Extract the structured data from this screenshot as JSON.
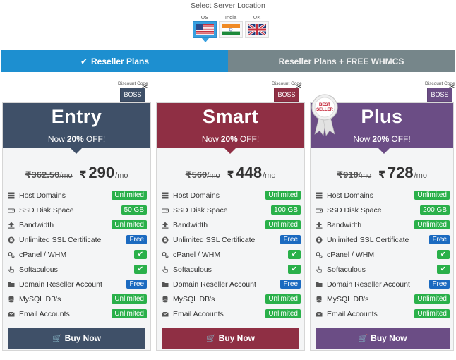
{
  "location": {
    "title": "Select Server Location",
    "flags": [
      {
        "label": "US",
        "active": true
      },
      {
        "label": "India",
        "active": false
      },
      {
        "label": "UK",
        "active": false
      }
    ]
  },
  "tabs": [
    {
      "label": "Reseller Plans",
      "active": true,
      "icon": "check-icon"
    },
    {
      "label": "Reseller Plans + FREE WHMCS",
      "active": false
    }
  ],
  "colors": {
    "entry": "#3f5068",
    "smart": "#8f2f44",
    "plus": "#6b4d85",
    "tab_active": "#1d8fd0",
    "tab_inactive": "#76868a",
    "green": "#2ab04a",
    "blue": "#1b6ac0"
  },
  "coupon": {
    "label": "Discount Code",
    "code": "BOSS"
  },
  "best_seller": {
    "line1": "BEST",
    "line2": "SELLER"
  },
  "plans": [
    {
      "name": "Entry",
      "off_prefix": "Now",
      "off_value": "20%",
      "off_suffix": "OFF!",
      "old_price": "₹362.50",
      "old_suffix": "/mo",
      "currency": "₹",
      "price": "290",
      "per": "/mo",
      "features": [
        {
          "name": "Host Domains",
          "value": "Unlimited",
          "type": "green",
          "icon": "server-icon"
        },
        {
          "name": "SSD Disk Space",
          "value": "50 GB",
          "type": "green",
          "icon": "hdd-icon"
        },
        {
          "name": "Bandwidth",
          "value": "Unlimited",
          "type": "green",
          "icon": "upload-icon"
        },
        {
          "name": "Unlimited SSL Certificate",
          "value": "Free",
          "type": "blue",
          "icon": "lock-icon"
        },
        {
          "name": "cPanel / WHM",
          "value": "✔",
          "type": "check",
          "icon": "gears-icon"
        },
        {
          "name": "Softaculous",
          "value": "✔",
          "type": "check",
          "icon": "hand-pointer-icon"
        },
        {
          "name": "Domain Reseller Account",
          "value": "Free",
          "type": "blue",
          "icon": "folder-icon"
        },
        {
          "name": "MySQL DB's",
          "value": "Unlimited",
          "type": "green",
          "icon": "database-icon"
        },
        {
          "name": "Email Accounts",
          "value": "Unlimited",
          "type": "green",
          "icon": "envelope-icon"
        }
      ],
      "buy_label": "Buy Now"
    },
    {
      "name": "Smart",
      "off_prefix": "Now",
      "off_value": "20%",
      "off_suffix": "OFF!",
      "old_price": "₹560",
      "old_suffix": "/mo",
      "currency": "₹",
      "price": "448",
      "per": "/mo",
      "features": [
        {
          "name": "Host Domains",
          "value": "Unlimited",
          "type": "green",
          "icon": "server-icon"
        },
        {
          "name": "SSD Disk Space",
          "value": "100 GB",
          "type": "green",
          "icon": "hdd-icon"
        },
        {
          "name": "Bandwidth",
          "value": "Unlimited",
          "type": "green",
          "icon": "upload-icon"
        },
        {
          "name": "Unlimited SSL Certificate",
          "value": "Free",
          "type": "blue",
          "icon": "lock-icon"
        },
        {
          "name": "cPanel / WHM",
          "value": "✔",
          "type": "check",
          "icon": "gears-icon"
        },
        {
          "name": "Softaculous",
          "value": "✔",
          "type": "check",
          "icon": "hand-pointer-icon"
        },
        {
          "name": "Domain Reseller Account",
          "value": "Free",
          "type": "blue",
          "icon": "folder-icon"
        },
        {
          "name": "MySQL DB's",
          "value": "Unlimited",
          "type": "green",
          "icon": "database-icon"
        },
        {
          "name": "Email Accounts",
          "value": "Unlimited",
          "type": "green",
          "icon": "envelope-icon"
        }
      ],
      "buy_label": "Buy Now"
    },
    {
      "name": "Plus",
      "off_prefix": "Now",
      "off_value": "20%",
      "off_suffix": "OFF!",
      "old_price": "₹910",
      "old_suffix": "/mo",
      "currency": "₹",
      "price": "728",
      "per": "/mo",
      "features": [
        {
          "name": "Host Domains",
          "value": "Unlimited",
          "type": "green",
          "icon": "server-icon"
        },
        {
          "name": "SSD Disk Space",
          "value": "200 GB",
          "type": "green",
          "icon": "hdd-icon"
        },
        {
          "name": "Bandwidth",
          "value": "Unlimited",
          "type": "green",
          "icon": "upload-icon"
        },
        {
          "name": "Unlimited SSL Certificate",
          "value": "Free",
          "type": "blue",
          "icon": "lock-icon"
        },
        {
          "name": "cPanel / WHM",
          "value": "✔",
          "type": "check",
          "icon": "gears-icon"
        },
        {
          "name": "Softaculous",
          "value": "✔",
          "type": "check",
          "icon": "hand-pointer-icon"
        },
        {
          "name": "Domain Reseller Account",
          "value": "Free",
          "type": "blue",
          "icon": "folder-icon"
        },
        {
          "name": "MySQL DB's",
          "value": "Unlimited",
          "type": "green",
          "icon": "database-icon"
        },
        {
          "name": "Email Accounts",
          "value": "Unlimited",
          "type": "green",
          "icon": "envelope-icon"
        }
      ],
      "buy_label": "Buy Now"
    }
  ]
}
